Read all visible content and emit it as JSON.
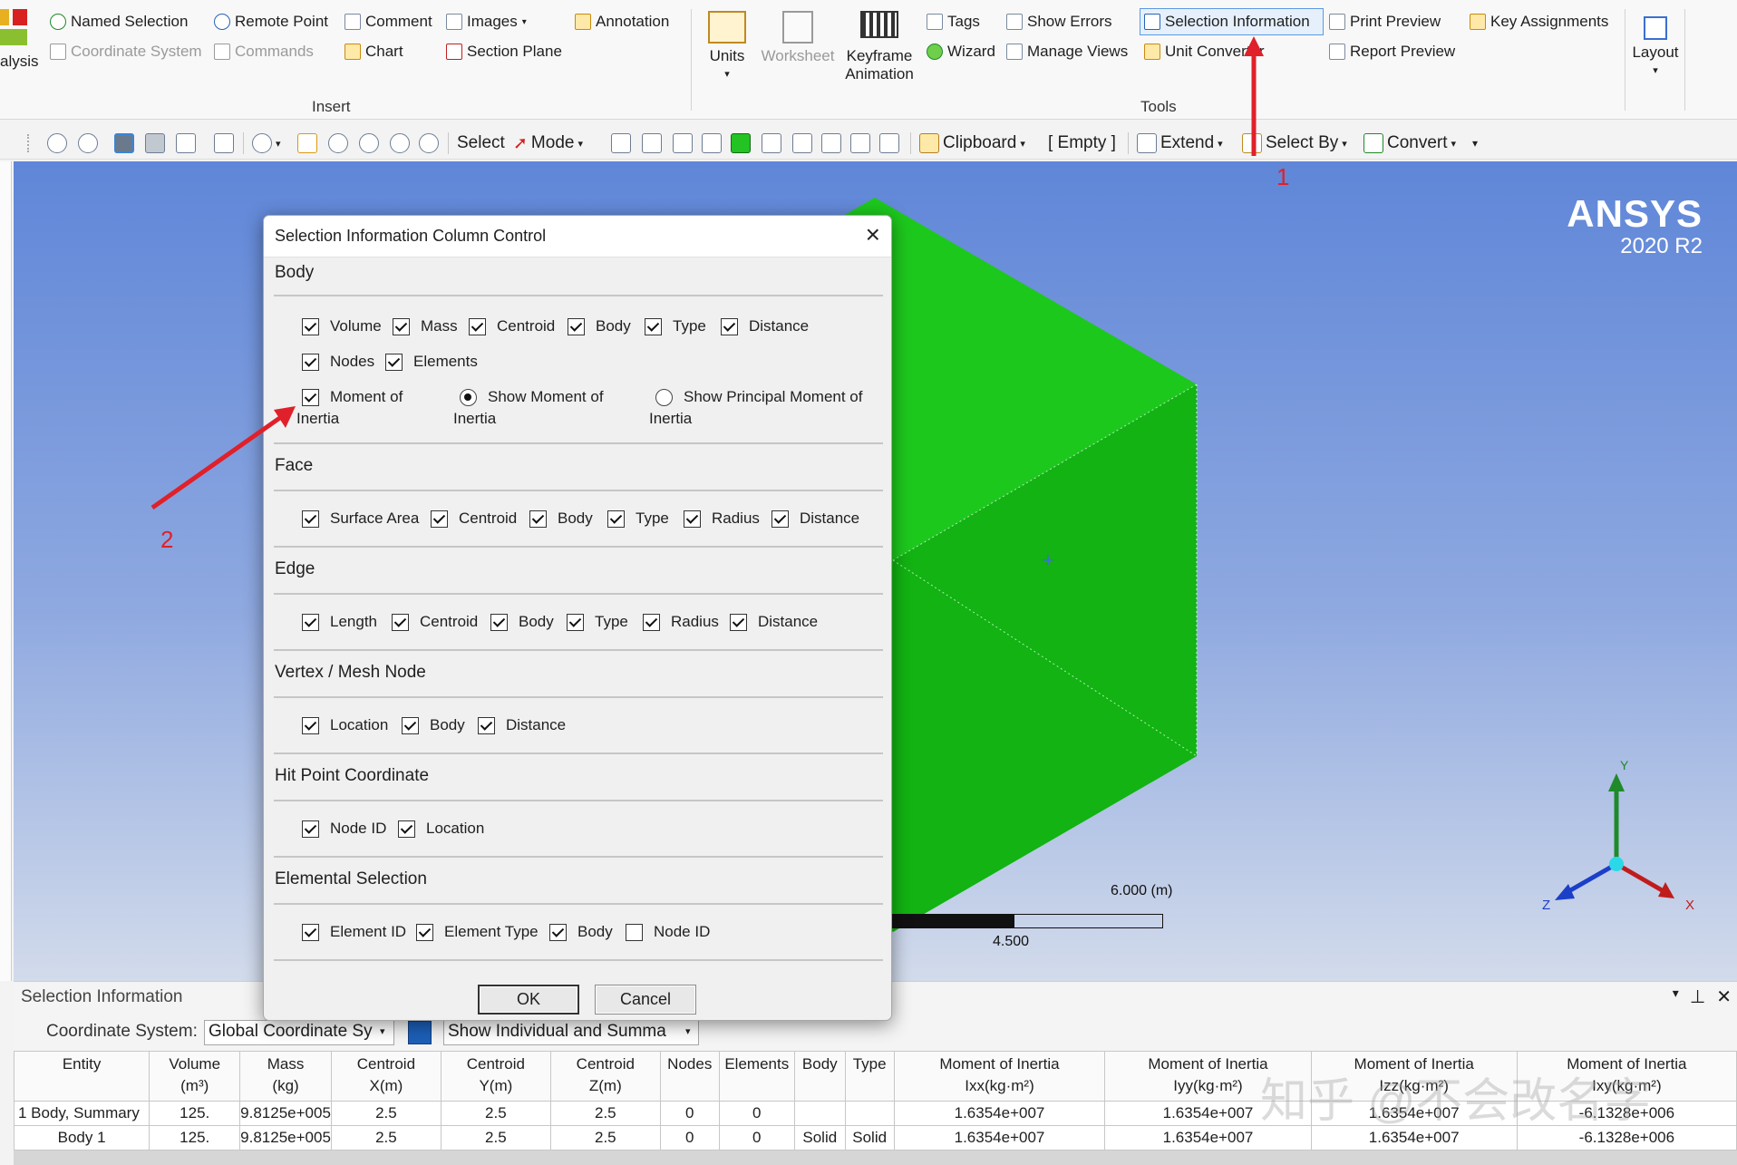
{
  "ribbon": {
    "left_cut_label": "alysis",
    "insert": {
      "named_selection": "Named Selection",
      "remote_point": "Remote Point",
      "comment": "Comment",
      "images": "Images",
      "coordinate_system": "Coordinate System",
      "commands": "Commands",
      "chart": "Chart",
      "section_plane": "Section Plane",
      "annotation": "Annotation",
      "group_label": "Insert"
    },
    "units": "Units",
    "worksheet": "Worksheet",
    "keyframe_1": "Keyframe",
    "keyframe_2": "Animation",
    "tools": {
      "tags": "Tags",
      "show_errors": "Show Errors",
      "selection_information": "Selection Information",
      "print_preview": "Print Preview",
      "key_assignments": "Key Assignments",
      "wizard": "Wizard",
      "manage_views": "Manage Views",
      "unit_converter": "Unit Converter",
      "report_preview": "Report Preview",
      "group_label": "Tools"
    },
    "layout": "Layout"
  },
  "toolbar": {
    "select": "Select",
    "mode": "Mode",
    "clipboard": "Clipboard",
    "empty": "[ Empty ]",
    "extend": "Extend",
    "select_by": "Select By",
    "convert": "Convert"
  },
  "viewport": {
    "logo_name": "ANSYS",
    "logo_version": "2020 R2",
    "scale_max": "6.000 (m)",
    "scale_mid": "4.500",
    "triad_y": "Y",
    "triad_z": "Z",
    "triad_x": "X",
    "cube_color": "#16c016"
  },
  "annotations": {
    "marker_1": "1",
    "marker_2": "2",
    "color": "#e0202a"
  },
  "dialog": {
    "title": "Selection Information Column Control",
    "body": {
      "heading": "Body",
      "volume": "Volume",
      "mass": "Mass",
      "centroid": "Centroid",
      "body": "Body",
      "type": "Type",
      "distance": "Distance",
      "nodes": "Nodes",
      "elements": "Elements",
      "moi_1": "Moment of",
      "moi_2": "Inertia",
      "show_moi_1": "Show Moment of",
      "show_moi_2": "Inertia",
      "show_pmoi_1": "Show Principal Moment of",
      "show_pmoi_2": "Inertia"
    },
    "face": {
      "heading": "Face",
      "surface_area": "Surface Area",
      "centroid": "Centroid",
      "body": "Body",
      "type": "Type",
      "radius": "Radius",
      "distance": "Distance"
    },
    "edge": {
      "heading": "Edge",
      "length": "Length",
      "centroid": "Centroid",
      "body": "Body",
      "type": "Type",
      "radius": "Radius",
      "distance": "Distance"
    },
    "vertex": {
      "heading": "Vertex / Mesh Node",
      "location": "Location",
      "body": "Body",
      "distance": "Distance"
    },
    "hit": {
      "heading": "Hit Point Coordinate",
      "node_id": "Node ID",
      "location": "Location"
    },
    "elemental": {
      "heading": "Elemental Selection",
      "element_id": "Element ID",
      "element_type": "Element Type",
      "body": "Body",
      "node_id": "Node ID"
    },
    "ok": "OK",
    "cancel": "Cancel"
  },
  "bottom_panel": {
    "title": "Selection Information",
    "coordinate_system_label": "Coordinate System:",
    "coordinate_system_value": "Global Coordinate Sy",
    "display_mode_value": "Show Individual and Summa",
    "columns": [
      [
        "Entity",
        ""
      ],
      [
        "Volume",
        "(m³)"
      ],
      [
        "Mass",
        "(kg)"
      ],
      [
        "Centroid",
        "X(m)"
      ],
      [
        "Centroid",
        "Y(m)"
      ],
      [
        "Centroid",
        "Z(m)"
      ],
      [
        "Nodes",
        ""
      ],
      [
        "Elements",
        ""
      ],
      [
        "Body",
        ""
      ],
      [
        "Type",
        ""
      ],
      [
        "Moment of Inertia",
        "Ixx(kg·m²)"
      ],
      [
        "Moment of Inertia",
        "Iyy(kg·m²)"
      ],
      [
        "Moment of Inertia",
        "Izz(kg·m²)"
      ],
      [
        "Moment of Inertia",
        "Ixy(kg·m²)"
      ]
    ],
    "rows": [
      [
        "1 Body, Summary",
        "125.",
        "9.8125e+005",
        "2.5",
        "2.5",
        "2.5",
        "0",
        "0",
        "",
        "",
        "1.6354e+007",
        "1.6354e+007",
        "1.6354e+007",
        "-6.1328e+006"
      ],
      [
        "Body 1",
        "125.",
        "9.8125e+005",
        "2.5",
        "2.5",
        "2.5",
        "0",
        "0",
        "Solid",
        "Solid",
        "1.6354e+007",
        "1.6354e+007",
        "1.6354e+007",
        "-6.1328e+006"
      ]
    ]
  },
  "watermark": "知乎 @不会改名字"
}
